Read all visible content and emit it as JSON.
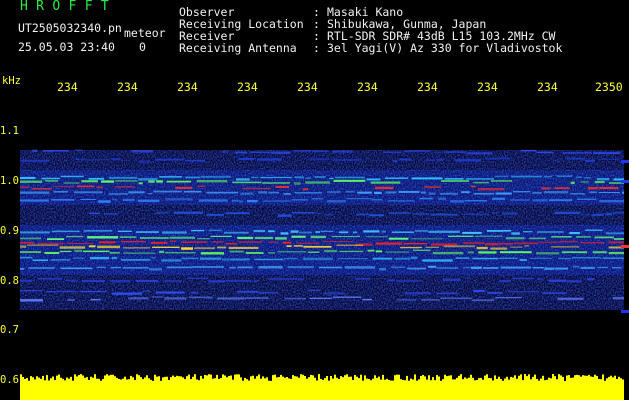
{
  "header": {
    "logo": "H R O F F T",
    "filename": "UT2505032340.pn",
    "meteor_tag": "meteor",
    "timestamp": "25.05.03 23:40",
    "count": "0"
  },
  "info": [
    {
      "label": "Observer",
      "value": "Masaki Kano"
    },
    {
      "label": "Receiving Location",
      "value": "Shibukawa, Gunma, Japan"
    },
    {
      "label": "Receiver",
      "value": "RTL-SDR SDR# 43dB L15 103.2MHz CW"
    },
    {
      "label": "Receiving Antenna",
      "value": "3el Yagi(V) Az 330 for Vladivostok"
    }
  ],
  "axis": {
    "y_unit": "kHz",
    "y_ticks": [
      "1.1",
      "1.0",
      "0.9",
      "0.8",
      "0.7",
      "0.6"
    ],
    "x_ticks": [
      "234",
      "234",
      "234",
      "234",
      "234",
      "234",
      "234",
      "234",
      "234",
      "2350"
    ]
  },
  "colors": {
    "text_green": "#22ee44",
    "text_white": "#f0f0f0",
    "text_yellow": "#ffff33",
    "background": "#000000",
    "signal_red": "#ff2020",
    "noise_blue": "#1010c0"
  }
}
